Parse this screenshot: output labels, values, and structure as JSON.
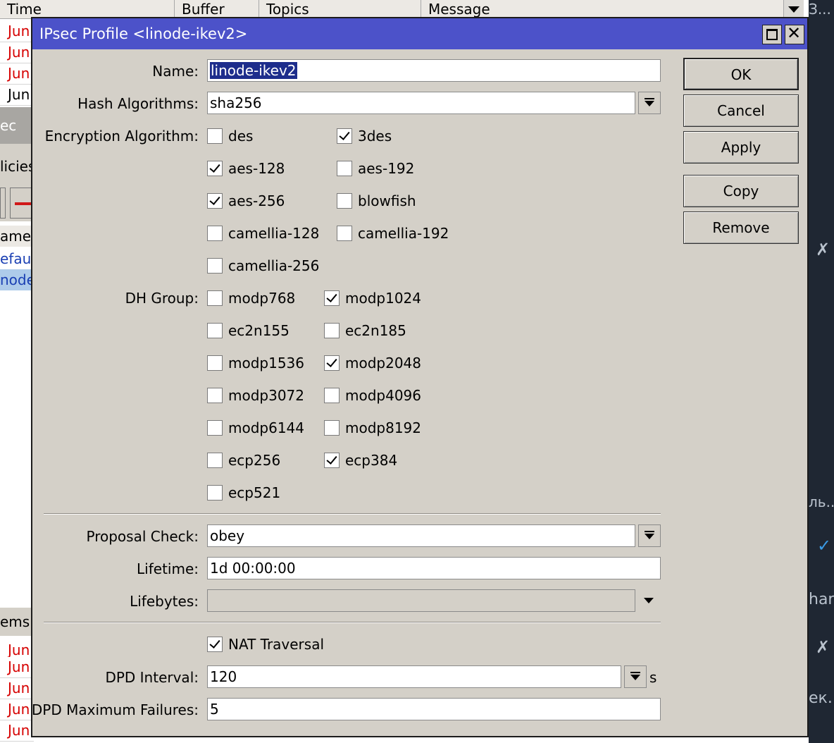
{
  "background": {
    "columns": [
      "Time",
      "Buffer",
      "Topics",
      "Message"
    ],
    "log_rows": [
      "Jun",
      "Jun",
      "Jun",
      "Jun"
    ],
    "log_rows_bottom": [
      "Jun",
      "Jun",
      "Jun",
      "Jun",
      "Jun"
    ],
    "left_labels": {
      "tab": "ec",
      "policies": "licies",
      "name_col": "ame",
      "row1": "efau",
      "row2": "node",
      "items": "ems"
    },
    "right_labels": {
      "top": "З...",
      "mid": "ль...",
      "hard": "hard",
      "ek": "ек."
    }
  },
  "dialog": {
    "title": "IPsec Profile <linode-ikev2>",
    "name": {
      "label": "Name:",
      "value": "linode-ikev2"
    },
    "hash": {
      "label": "Hash Algorithms:",
      "value": "sha256"
    },
    "encryption": {
      "label": "Encryption Algorithm:",
      "options": [
        {
          "name": "des",
          "checked": false
        },
        {
          "name": "3des",
          "checked": true
        },
        {
          "name": "aes-128",
          "checked": true
        },
        {
          "name": "aes-192",
          "checked": false
        },
        {
          "name": "aes-256",
          "checked": true
        },
        {
          "name": "blowfish",
          "checked": false
        },
        {
          "name": "camellia-128",
          "checked": false
        },
        {
          "name": "camellia-192",
          "checked": false
        },
        {
          "name": "camellia-256",
          "checked": false
        }
      ]
    },
    "dh_group": {
      "label": "DH Group:",
      "options": [
        {
          "name": "modp768",
          "checked": false
        },
        {
          "name": "modp1024",
          "checked": true
        },
        {
          "name": "ec2n155",
          "checked": false
        },
        {
          "name": "ec2n185",
          "checked": false
        },
        {
          "name": "modp1536",
          "checked": false
        },
        {
          "name": "modp2048",
          "checked": true
        },
        {
          "name": "modp3072",
          "checked": false
        },
        {
          "name": "modp4096",
          "checked": false
        },
        {
          "name": "modp6144",
          "checked": false
        },
        {
          "name": "modp8192",
          "checked": false
        },
        {
          "name": "ecp256",
          "checked": false
        },
        {
          "name": "ecp384",
          "checked": true
        },
        {
          "name": "ecp521",
          "checked": false
        }
      ]
    },
    "proposal_check": {
      "label": "Proposal Check:",
      "value": "obey"
    },
    "lifetime": {
      "label": "Lifetime:",
      "value": "1d 00:00:00"
    },
    "lifebytes": {
      "label": "Lifebytes:",
      "value": ""
    },
    "nat_traversal": {
      "label": "NAT Traversal",
      "checked": true
    },
    "dpd_interval": {
      "label": "DPD Interval:",
      "value": "120",
      "unit": "s"
    },
    "dpd_max_failures": {
      "label": "DPD Maximum Failures:",
      "value": "5"
    },
    "buttons": {
      "ok": "OK",
      "cancel": "Cancel",
      "apply": "Apply",
      "copy": "Copy",
      "remove": "Remove"
    }
  }
}
